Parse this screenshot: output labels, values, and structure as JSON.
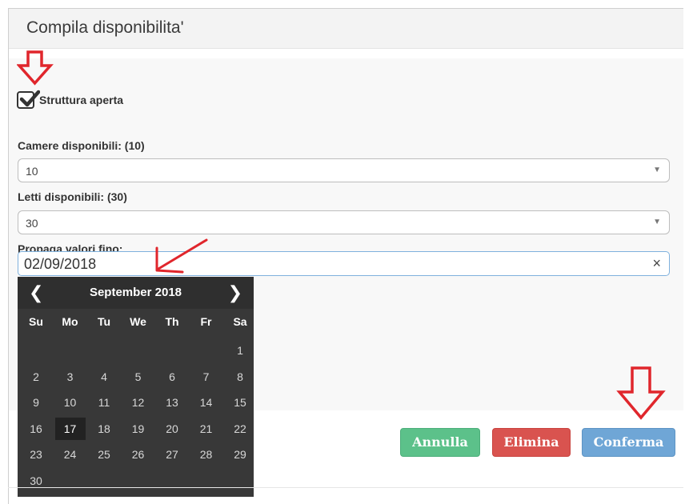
{
  "modal": {
    "title": "Compila disponibilita'"
  },
  "checkbox": {
    "label": "Struttura aperta",
    "checked": true
  },
  "camere": {
    "label": "Camere disponibili: (10)",
    "value": "10"
  },
  "letti": {
    "label": "Letti disponibili: (30)",
    "value": "30"
  },
  "propaga": {
    "label": "Propaga valori fino:",
    "value": "02/09/2018",
    "clear": "×"
  },
  "calendar": {
    "title": "September 2018",
    "prev": "❮",
    "next": "❯",
    "weekdays": [
      "Su",
      "Mo",
      "Tu",
      "We",
      "Th",
      "Fr",
      "Sa"
    ],
    "weeks": [
      [
        "",
        "",
        "",
        "",
        "",
        "",
        "1"
      ],
      [
        "2",
        "3",
        "4",
        "5",
        "6",
        "7",
        "8"
      ],
      [
        "9",
        "10",
        "11",
        "12",
        "13",
        "14",
        "15"
      ],
      [
        "16",
        "17",
        "18",
        "19",
        "20",
        "21",
        "22"
      ],
      [
        "23",
        "24",
        "25",
        "26",
        "27",
        "28",
        "29"
      ],
      [
        "30",
        "",
        "",
        "",
        "",
        "",
        ""
      ]
    ],
    "selected_day": "17"
  },
  "buttons": {
    "annulla": "Annulla",
    "elimina": "Elimina",
    "conferma": "Conferma"
  },
  "colors": {
    "annotation_red": "#e0262c",
    "annulla_bg": "#5cc18a",
    "elimina_bg": "#d9534f",
    "conferma_bg": "#6fa6d6",
    "calendar_bg": "#383838"
  }
}
